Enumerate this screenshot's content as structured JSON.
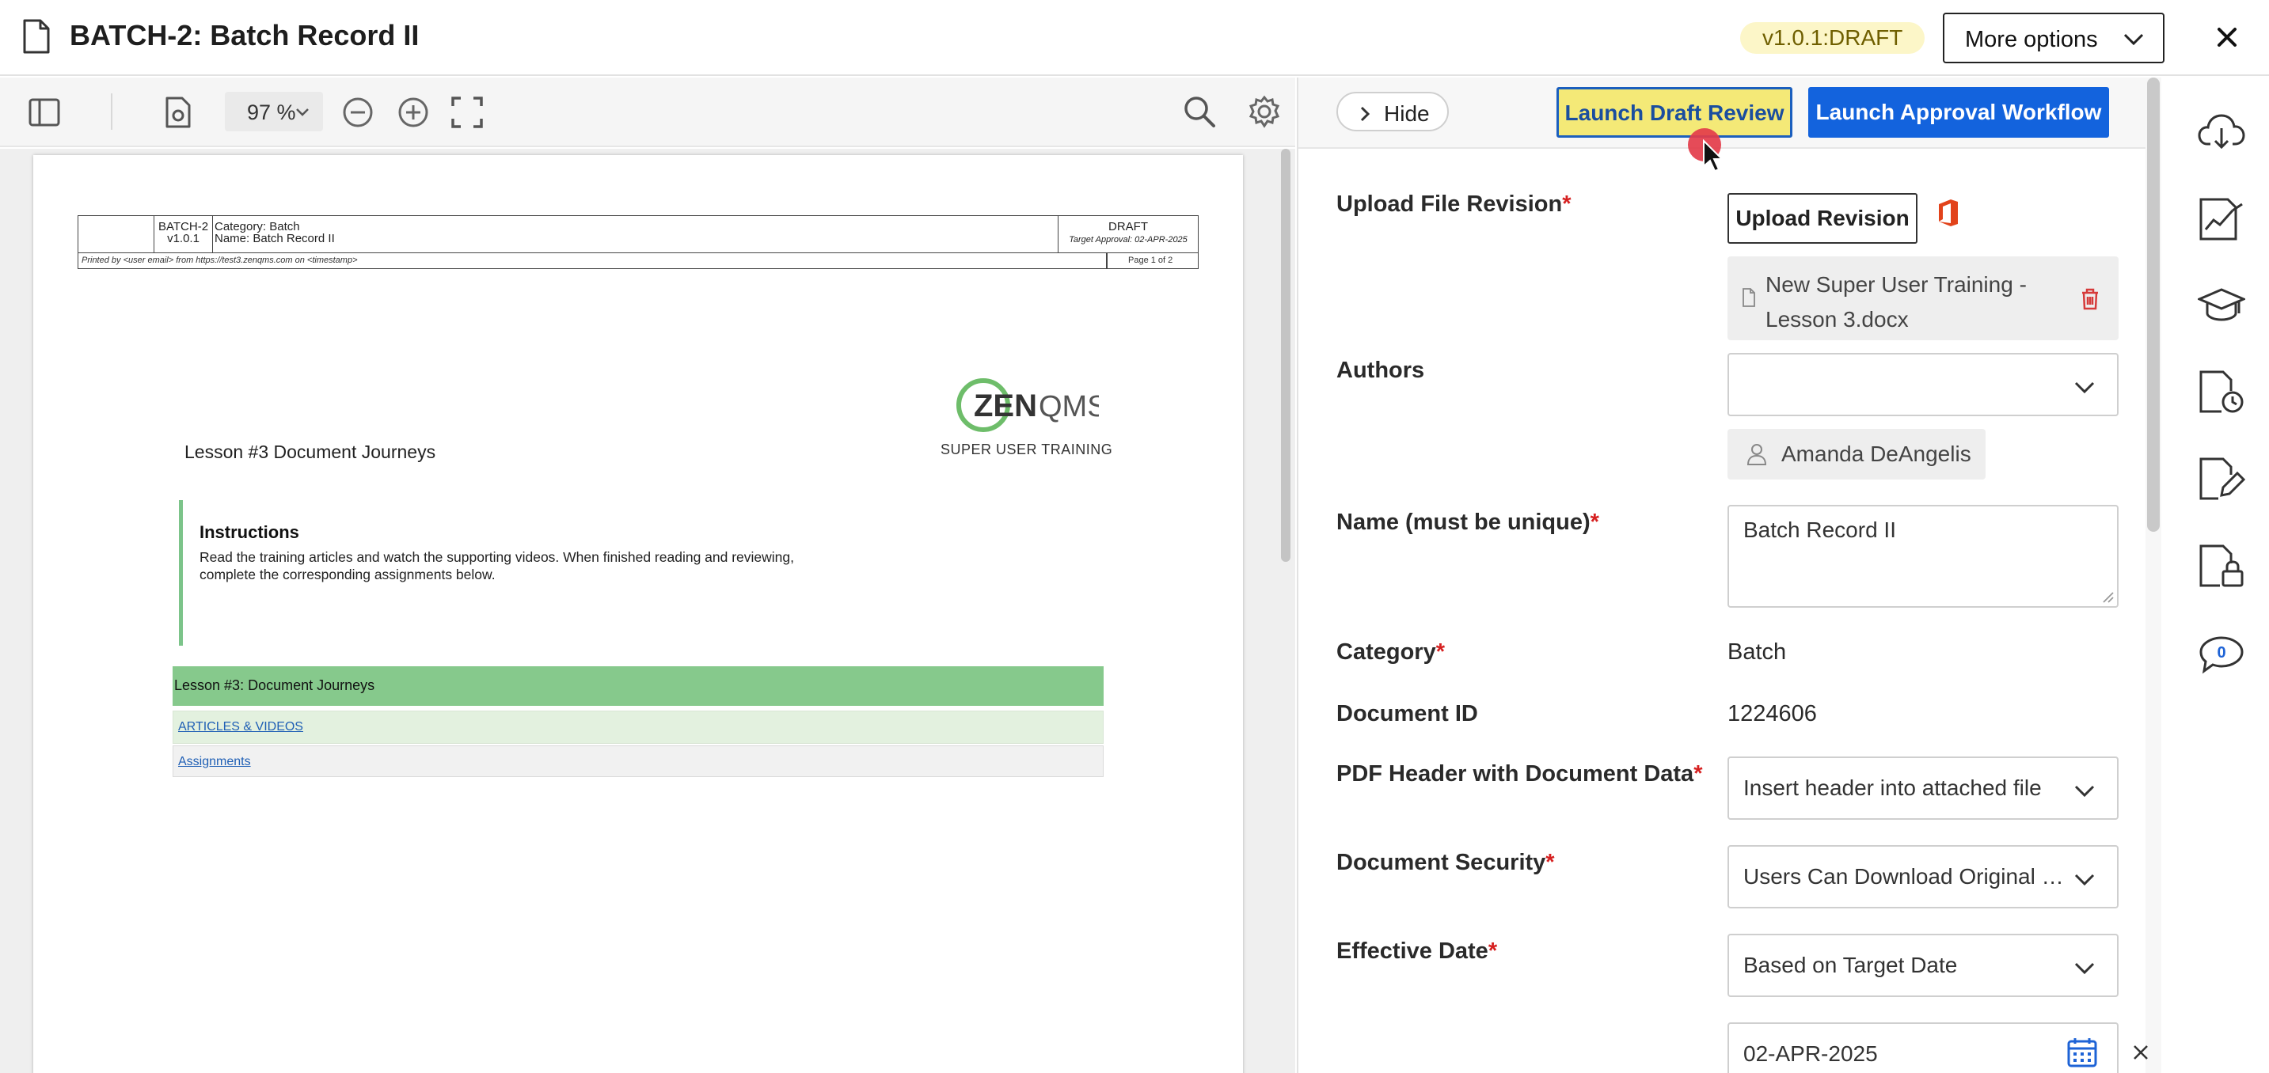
{
  "header": {
    "title": "BATCH-2: Batch Record II",
    "version_badge": "v1.0.1:DRAFT",
    "more_options_label": "More options"
  },
  "viewer": {
    "zoom": "97 %",
    "doc_header": {
      "doc_id": "BATCH-2",
      "version": "v1.0.1",
      "category_label": "Category:",
      "category_value": "Batch",
      "name_label": "Name:",
      "name_value": "Batch Record II",
      "status": "DRAFT",
      "target_approval": "Target Approval: 02-APR-2025",
      "printed_by": "Printed by <user email> from https://test3.zenqms.com on <timestamp>",
      "page": "Page 1 of 2"
    },
    "logo_text_bold": "ZEN",
    "logo_text_light": "QMS",
    "logo_subtitle": "SUPER USER TRAINING",
    "lesson_title": "Lesson #3 Document Journeys",
    "instructions_title": "Instructions",
    "instructions_text": "Read the training articles and watch the supporting videos. When finished reading and reviewing, complete the corresponding assignments below.",
    "lesson_bar": "Lesson #3: Document Journeys",
    "articles_link": "ARTICLES & VIDEOS",
    "assignments_link": "Assignments"
  },
  "panel": {
    "hide_label": "Hide",
    "launch_draft_review": "Launch Draft Review",
    "launch_approval_workflow": "Launch Approval Workflow",
    "upload_file_revision_label": "Upload File Revision",
    "upload_revision_button": "Upload Revision",
    "uploaded_file_name": "New Super User Training - Lesson 3.docx",
    "authors_label": "Authors",
    "authors_value": "",
    "author_chip": "Amanda DeAngelis",
    "name_label": "Name (must be unique)",
    "name_value": "Batch Record II",
    "category_label": "Category",
    "category_value": "Batch",
    "document_id_label": "Document ID",
    "document_id_value": "1224606",
    "pdf_header_label": "PDF Header with Document Data",
    "pdf_header_value": "Insert header into attached file",
    "document_security_label": "Document Security",
    "document_security_value": "Users Can Download Original F...",
    "effective_date_label": "Effective Date",
    "effective_date_value": "Based on Target Date",
    "target_date_value": "02-APR-2025",
    "required_marker": "*"
  },
  "rail": {
    "comments_count": "0"
  },
  "icons": {
    "document": "document-icon",
    "close": "close-icon",
    "sidebar_toggle": "sidebar-toggle-icon",
    "page_settings": "page-settings-icon",
    "zoom_out": "zoom-out-icon",
    "zoom_in": "zoom-in-icon",
    "fullscreen": "fullscreen-icon",
    "search": "search-icon",
    "settings": "gear-icon"
  },
  "colors": {
    "primary": "#1363dd",
    "highlight": "#f4e977",
    "required": "#d62020",
    "badge_bg": "#fcf6c8",
    "lesson_green": "#86c98c"
  }
}
